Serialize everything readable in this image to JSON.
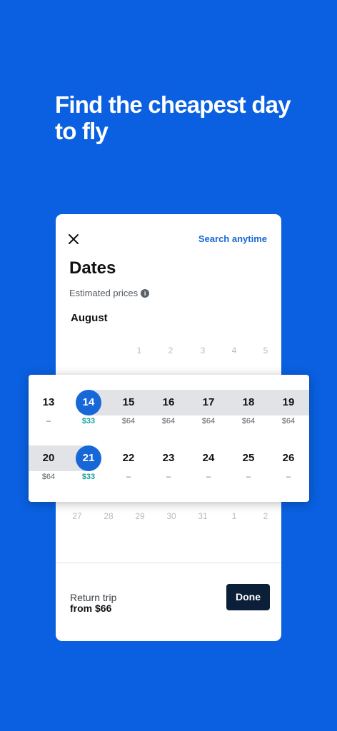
{
  "headline": "Find the cheapest day to fly",
  "card": {
    "close_icon": "close-icon",
    "search_anytime": "Search anytime",
    "title": "Dates",
    "estimated_prices": "Estimated prices",
    "info_icon": "info-icon",
    "month": "August",
    "top_row": [
      "1",
      "2",
      "3",
      "4",
      "5"
    ],
    "bottom_row": [
      "27",
      "28",
      "29",
      "30",
      "31",
      "1",
      "2"
    ],
    "return_label": "Return trip",
    "return_price": "from $66",
    "done": "Done"
  },
  "popup": {
    "week1": [
      {
        "day": "13",
        "price": "–"
      },
      {
        "day": "14",
        "price": "$33"
      },
      {
        "day": "15",
        "price": "$64"
      },
      {
        "day": "16",
        "price": "$64"
      },
      {
        "day": "17",
        "price": "$64"
      },
      {
        "day": "18",
        "price": "$64"
      },
      {
        "day": "19",
        "price": "$64"
      }
    ],
    "week2": [
      {
        "day": "20",
        "price": "$64"
      },
      {
        "day": "21",
        "price": "$33"
      },
      {
        "day": "22",
        "price": "–"
      },
      {
        "day": "23",
        "price": "–"
      },
      {
        "day": "24",
        "price": "–"
      },
      {
        "day": "25",
        "price": "–"
      },
      {
        "day": "26",
        "price": "–"
      }
    ]
  },
  "colors": {
    "background": "#0A60E0",
    "selected": "#1767D8",
    "cheap_price": "#1AA39B",
    "done_button": "#0C1F38",
    "range_band": "#E1E3E6"
  }
}
